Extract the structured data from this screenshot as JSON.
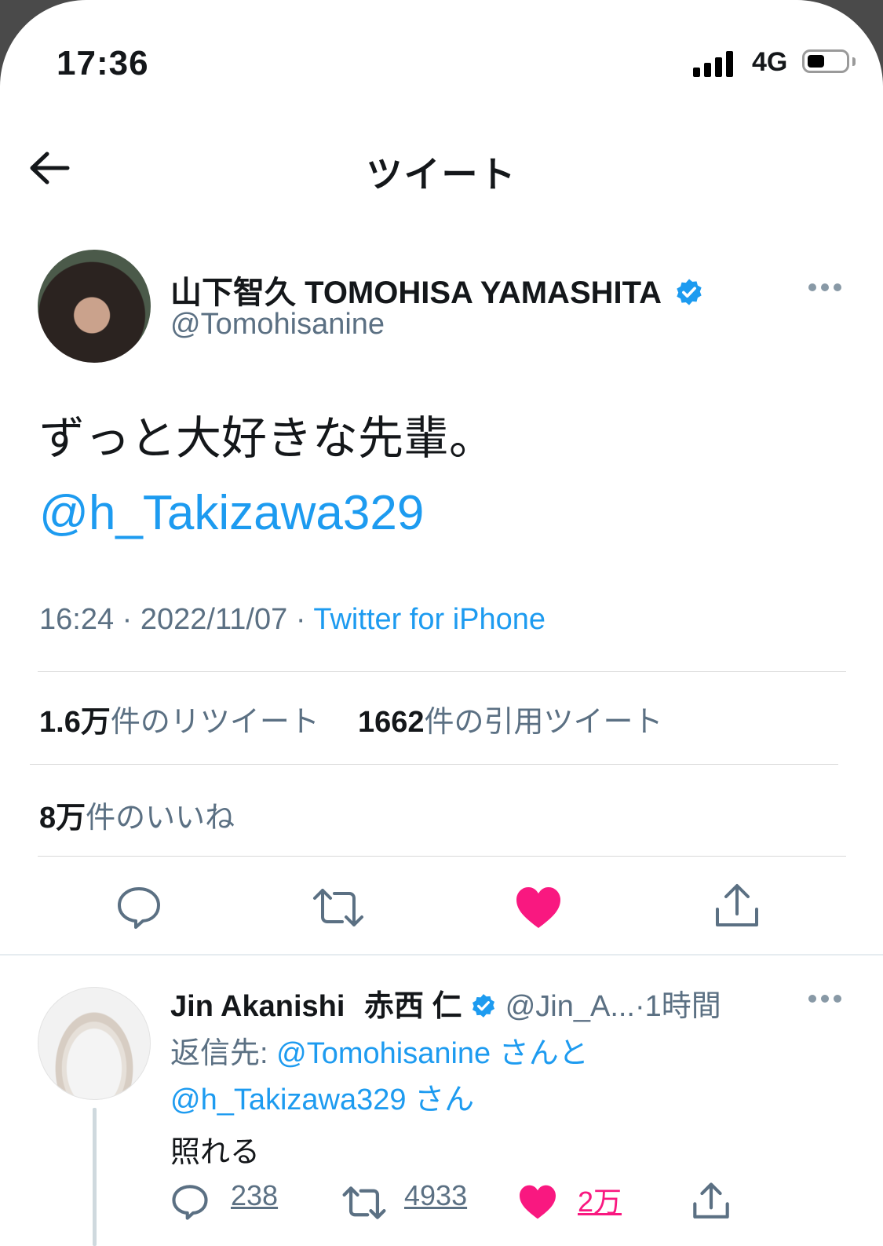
{
  "status_bar": {
    "time": "17:36",
    "network": "4G",
    "battery_level": 0.45
  },
  "header": {
    "title": "ツイート",
    "back_icon": "back-arrow-icon"
  },
  "tweet": {
    "author_name": "山下智久 TOMOHISA YAMASHITA",
    "author_handle": "@Tomohisanine",
    "verified": true,
    "text": "ずっと大好きな先輩。",
    "mention": "@h_Takizawa329",
    "time": "16:24",
    "separator": "·",
    "date": "2022/11/07",
    "source": "Twitter for iPhone",
    "retweets_count": "1.6万",
    "retweets_label": "件のリツイート",
    "quotes_count": "1662",
    "quotes_label": "件の引用ツイート",
    "likes_count": "8万",
    "likes_label": "件のいいね",
    "liked": true
  },
  "reply": {
    "author_name": "Jin Akanishi",
    "author_name_jp": "赤西 仁",
    "author_handle": "@Jin_A...",
    "separator": "·",
    "time_ago": "1時間",
    "reply_to_label": "返信先:",
    "reply_to_1": "@Tomohisanine",
    "reply_to_1_suffix": "さんと",
    "reply_to_2": "@h_Takizawa329",
    "reply_to_2_suffix": "さん",
    "text": "照れる",
    "replies": "238",
    "retweets": "4933",
    "likes": "2万"
  },
  "colors": {
    "accent": "#1d9bf0",
    "like": "#f91880",
    "secondary_text": "#5b7083"
  }
}
